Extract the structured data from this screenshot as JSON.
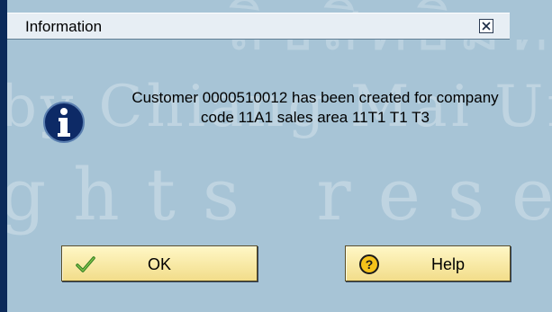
{
  "dialog": {
    "title": "Information",
    "message_line1": "Customer 0000510012 has been created for company",
    "message_line2": "code 11A1 sales area 11T1 T1 T3",
    "buttons": {
      "ok_label": "OK",
      "help_label": "Help"
    },
    "icons": {
      "info": "info-icon",
      "ok": "checkmark-icon",
      "help": "help-icon",
      "close": "close-icon"
    }
  },
  "watermark": {
    "line1": "ลิขสิทธิ์มหาวิทยาลัย",
    "line2": "by Chiang Mai Uni",
    "line3": "ghts reser"
  },
  "colors": {
    "background": "#a7c4d6",
    "titlebar": "#e7eef4",
    "button": "#f6e7a6",
    "left_edge": "#0b2a5a",
    "info_icon": "#0d2a66"
  }
}
